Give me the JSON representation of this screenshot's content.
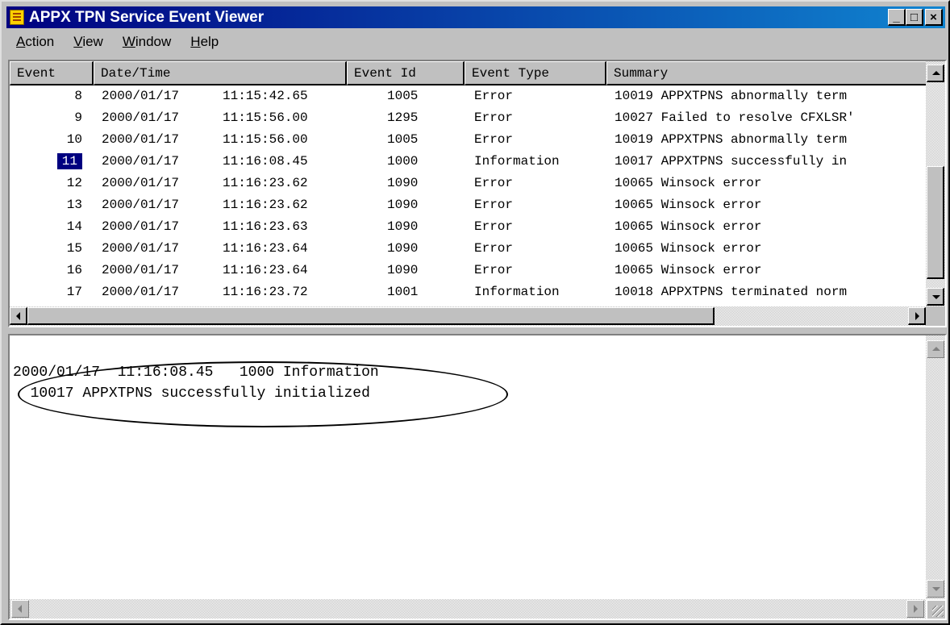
{
  "window": {
    "title": "APPX TPN Service Event Viewer",
    "icon": "app-icon",
    "controls": {
      "minimize": "_",
      "maximize": "□",
      "close": "×"
    }
  },
  "menu": {
    "items": [
      {
        "key": "A",
        "rest": "ction"
      },
      {
        "key": "V",
        "rest": "iew"
      },
      {
        "key": "W",
        "rest": "indow"
      },
      {
        "key": "H",
        "rest": "elp"
      }
    ]
  },
  "table": {
    "columns": [
      "Event",
      "Date/Time",
      "Event Id",
      "Event Type",
      "Summary"
    ],
    "selected_event": "11",
    "rows": [
      {
        "event": "8",
        "date": "2000/01/17",
        "time": "11:15:42.65",
        "id": "1005",
        "type": "Error",
        "summary": "10019 APPXTPNS abnormally term"
      },
      {
        "event": "9",
        "date": "2000/01/17",
        "time": "11:15:56.00",
        "id": "1295",
        "type": "Error",
        "summary": "10027 Failed to resolve CFXLSR'"
      },
      {
        "event": "10",
        "date": "2000/01/17",
        "time": "11:15:56.00",
        "id": "1005",
        "type": "Error",
        "summary": "10019 APPXTPNS abnormally term"
      },
      {
        "event": "11",
        "date": "2000/01/17",
        "time": "11:16:08.45",
        "id": "1000",
        "type": "Information",
        "summary": "10017 APPXTPNS successfully in"
      },
      {
        "event": "12",
        "date": "2000/01/17",
        "time": "11:16:23.62",
        "id": "1090",
        "type": "Error",
        "summary": "10065 Winsock error"
      },
      {
        "event": "13",
        "date": "2000/01/17",
        "time": "11:16:23.62",
        "id": "1090",
        "type": "Error",
        "summary": "10065 Winsock error"
      },
      {
        "event": "14",
        "date": "2000/01/17",
        "time": "11:16:23.63",
        "id": "1090",
        "type": "Error",
        "summary": "10065 Winsock error"
      },
      {
        "event": "15",
        "date": "2000/01/17",
        "time": "11:16:23.64",
        "id": "1090",
        "type": "Error",
        "summary": "10065 Winsock error"
      },
      {
        "event": "16",
        "date": "2000/01/17",
        "time": "11:16:23.64",
        "id": "1090",
        "type": "Error",
        "summary": "10065 Winsock error"
      },
      {
        "event": "17",
        "date": "2000/01/17",
        "time": "11:16:23.72",
        "id": "1001",
        "type": "Information",
        "summary": "10018 APPXTPNS terminated norm"
      }
    ]
  },
  "detail": {
    "line1": "2000/01/17  11:16:08.45   1000 Information",
    "line2": "  10017 APPXTPNS successfully initialized"
  },
  "colors": {
    "title_bar": "#000080",
    "selection": "#000080",
    "face": "#c0c0c0"
  }
}
